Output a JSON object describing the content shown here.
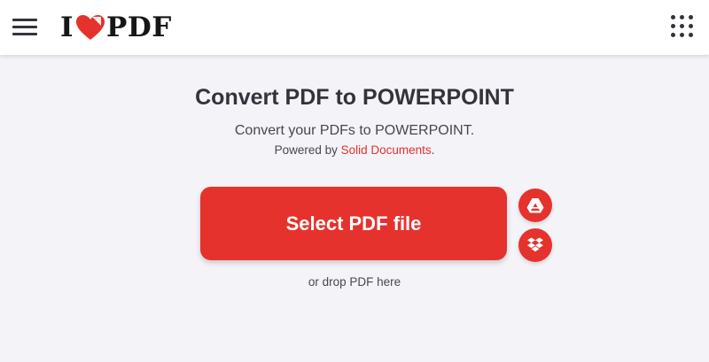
{
  "header": {
    "logo_left": "I",
    "logo_right": "PDF",
    "menu_icon": "hamburger-menu-icon",
    "apps_icon": "grid-apps-icon"
  },
  "main": {
    "title": "Convert PDF to POWERPOINT",
    "subtitle": "Convert your PDFs to POWERPOINT.",
    "powered_prefix": "Powered by ",
    "powered_link": "Solid Documents",
    "powered_suffix": ".",
    "select_button": "Select PDF file",
    "drop_text": "or drop PDF here",
    "cloud_buttons": [
      {
        "icon": "google-drive-icon"
      },
      {
        "icon": "dropbox-icon"
      }
    ]
  },
  "colors": {
    "accent": "#e5322d",
    "text": "#33333b",
    "background": "#f4f3f8",
    "header_bg": "#ffffff"
  }
}
